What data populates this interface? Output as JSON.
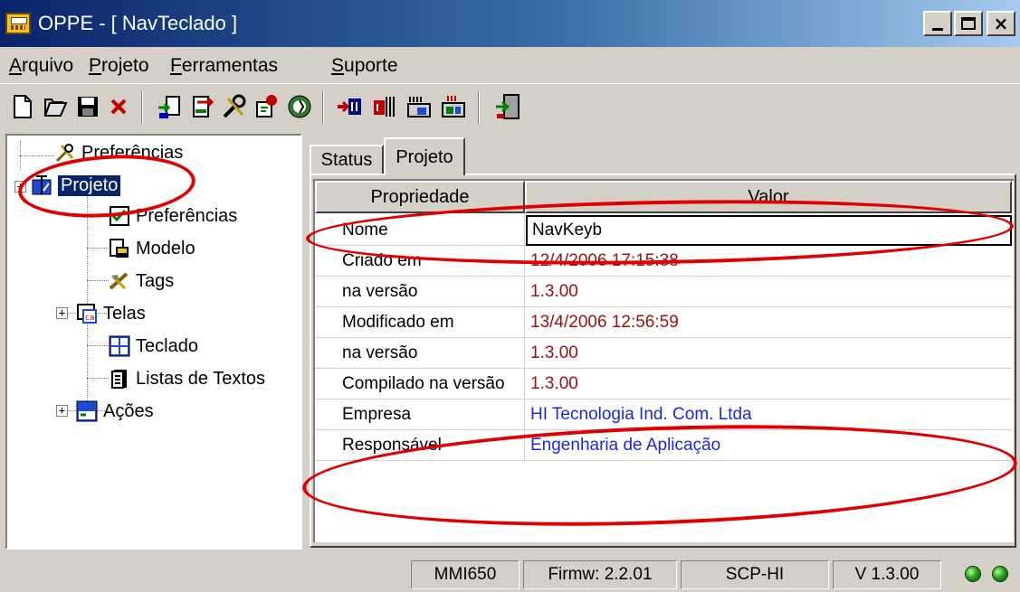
{
  "window": {
    "title": "OPPE - [ NavTeclado ]",
    "minimize_glyph": "_",
    "maximize_glyph": "□",
    "close_glyph": "×"
  },
  "menu": [
    {
      "label_first": "A",
      "label_rest": "rquivo"
    },
    {
      "label_first": "P",
      "label_rest": "rojeto"
    },
    {
      "label_first": "F",
      "label_rest": "erramentas"
    },
    {
      "label_first": "S",
      "label_rest": "uporte"
    }
  ],
  "toolbar": {
    "icons": [
      "new-file-icon",
      "open-folder-icon",
      "save-disk-icon",
      "delete-x-icon",
      "import-icon",
      "export-icon",
      "tools-icon",
      "compile-icon",
      "refresh-icon",
      "connect-icon",
      "transfer-icon",
      "download-icon",
      "upload-icon",
      "exit-icon"
    ]
  },
  "tree": {
    "items": [
      {
        "label": "Preferências",
        "icon": "tools-icon"
      },
      {
        "label": "Projeto",
        "icon": "project-icon",
        "selected": true
      },
      {
        "label": "Preferências",
        "icon": "preferences-icon"
      },
      {
        "label": "Modelo",
        "icon": "model-icon"
      },
      {
        "label": "Tags",
        "icon": "tags-icon"
      },
      {
        "label": "Telas",
        "icon": "screens-icon"
      },
      {
        "label": "Teclado",
        "icon": "keyboard-icon"
      },
      {
        "label": "Listas de Textos",
        "icon": "text-lists-icon"
      },
      {
        "label": "Ações",
        "icon": "actions-icon"
      }
    ],
    "expander_glyph": "+"
  },
  "tabs": [
    {
      "label": "Status"
    },
    {
      "label": "Projeto",
      "active": true
    }
  ],
  "grid": {
    "headers": {
      "property": "Propriedade",
      "value": "Valor"
    },
    "rows": [
      {
        "property": "Nome",
        "value": "NavKeyb",
        "color": "#000000"
      },
      {
        "property": "Criado em",
        "value": "12/4/2006 17:15:38",
        "color": "#a01010"
      },
      {
        "property": "na versão",
        "value": "1.3.00",
        "color": "#a01010"
      },
      {
        "property": "Modificado em",
        "value": "13/4/2006 12:56:59",
        "color": "#a01010"
      },
      {
        "property": "na versão",
        "value": "1.3.00",
        "color": "#a01010"
      },
      {
        "property": "Compilado na versão",
        "value": "1.3.00",
        "color": "#a01010"
      },
      {
        "property": "Empresa",
        "value": "HI Tecnologia Ind. Com. Ltda",
        "color": "#1a2ad8"
      },
      {
        "property": "Responsável",
        "value": "Engenharia de Aplicação",
        "color": "#1a2ad8"
      }
    ]
  },
  "statusbar": {
    "device": "MMI650",
    "firmware": "Firmw: 2.2.01",
    "protocol": "SCP-HI",
    "version": "V 1.3.00"
  },
  "colors": {
    "annotation": "#e00000",
    "selection": "#0a246a",
    "led": "#2aa020"
  }
}
